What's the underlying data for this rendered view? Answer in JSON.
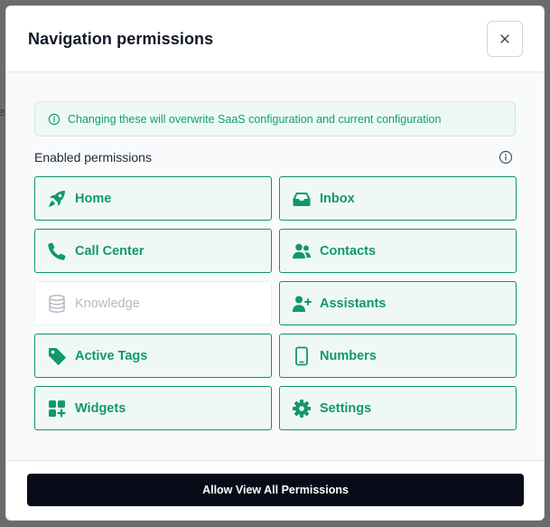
{
  "modal": {
    "title": "Navigation permissions",
    "close_icon": "close-icon"
  },
  "alert": {
    "icon": "info-circle-icon",
    "text": "Changing these will overwrite SaaS configuration and current configuration"
  },
  "section": {
    "label": "Enabled permissions",
    "info_icon": "info-circle-icon"
  },
  "permissions": [
    {
      "label": "Home",
      "icon": "rocket-icon",
      "enabled": true
    },
    {
      "label": "Inbox",
      "icon": "inbox-tray-icon",
      "enabled": true
    },
    {
      "label": "Call Center",
      "icon": "phone-icon",
      "enabled": true
    },
    {
      "label": "Contacts",
      "icon": "users-icon",
      "enabled": true
    },
    {
      "label": "Knowledge",
      "icon": "database-icon",
      "enabled": false
    },
    {
      "label": "Assistants",
      "icon": "user-plus-icon",
      "enabled": true
    },
    {
      "label": "Active Tags",
      "icon": "tag-icon",
      "enabled": true
    },
    {
      "label": "Numbers",
      "icon": "mobile-phone-icon",
      "enabled": true
    },
    {
      "label": "Widgets",
      "icon": "widgets-icon",
      "enabled": true
    },
    {
      "label": "Settings",
      "icon": "gear-icon",
      "enabled": true
    }
  ],
  "footer": {
    "button_label": "Allow View All Permissions"
  },
  "colors": {
    "accent": "#10996b",
    "disabled": "#b5bac3",
    "button_bg": "#070b18"
  }
}
